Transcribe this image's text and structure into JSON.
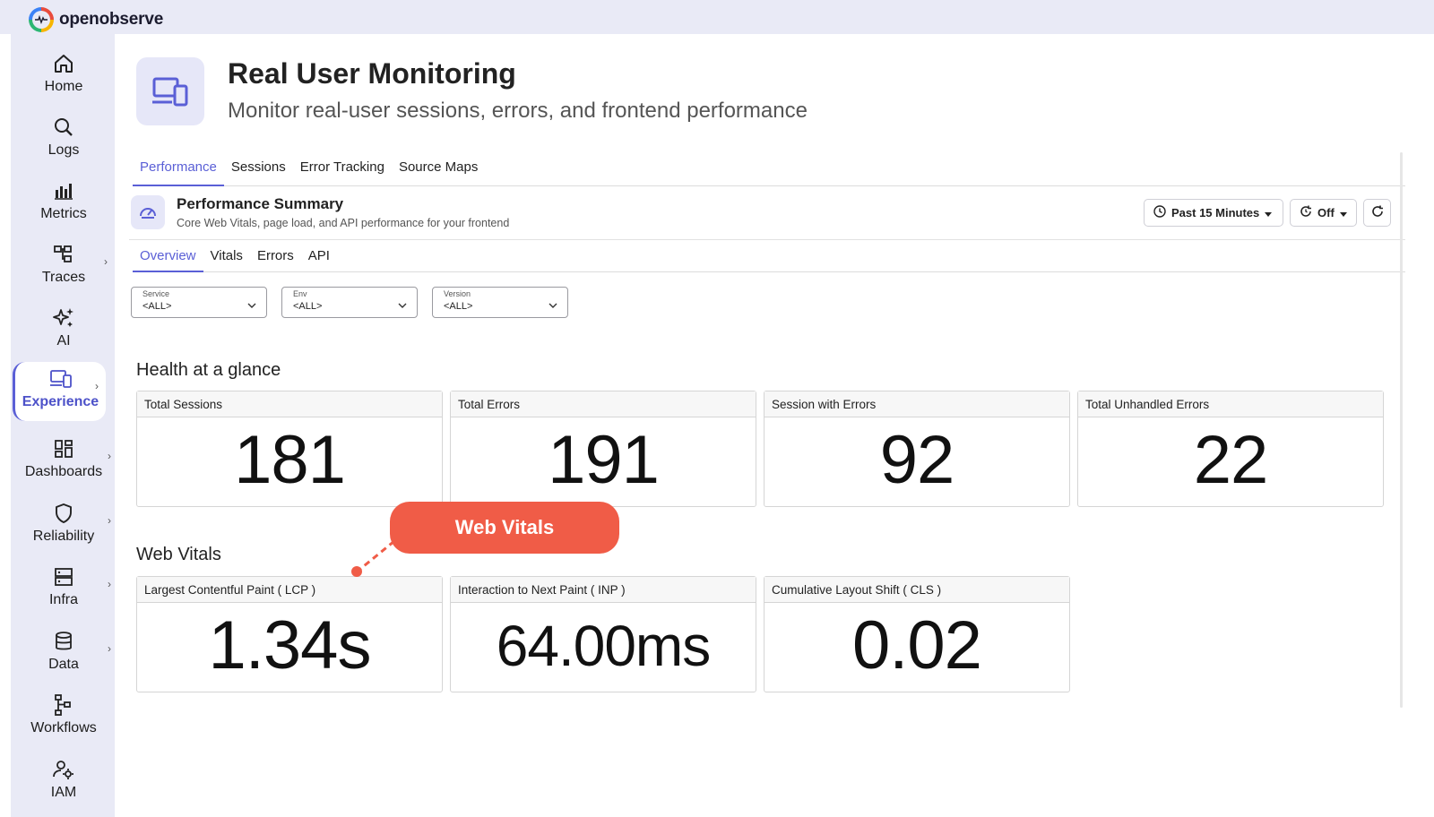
{
  "app": {
    "brand": "openobserve"
  },
  "sidebar": {
    "items": [
      {
        "label": "Home",
        "icon": "home-icon"
      },
      {
        "label": "Logs",
        "icon": "search-icon"
      },
      {
        "label": "Metrics",
        "icon": "bar-chart-icon"
      },
      {
        "label": "Traces",
        "icon": "traces-icon"
      },
      {
        "label": "AI",
        "icon": "sparkles-icon"
      },
      {
        "label": "Experience",
        "icon": "devices-icon",
        "active": true
      },
      {
        "label": "Dashboards",
        "icon": "dashboard-grid-icon"
      },
      {
        "label": "Reliability",
        "icon": "shield-icon"
      },
      {
        "label": "Infra",
        "icon": "server-icon"
      },
      {
        "label": "Data",
        "icon": "database-icon"
      },
      {
        "label": "Workflows",
        "icon": "workflow-icon"
      },
      {
        "label": "IAM",
        "icon": "user-gear-icon"
      }
    ]
  },
  "header": {
    "title": "Real User Monitoring",
    "subtitle": "Monitor real-user sessions, errors, and frontend performance"
  },
  "tabs": [
    {
      "label": "Performance",
      "active": true
    },
    {
      "label": "Sessions"
    },
    {
      "label": "Error Tracking"
    },
    {
      "label": "Source Maps"
    }
  ],
  "summary": {
    "title": "Performance Summary",
    "description": "Core Web Vitals, page load, and API performance for your frontend",
    "time_range": "Past 15 Minutes",
    "refresh": "Off"
  },
  "subtabs": [
    {
      "label": "Overview",
      "active": true
    },
    {
      "label": "Vitals"
    },
    {
      "label": "Errors"
    },
    {
      "label": "API"
    }
  ],
  "filters": [
    {
      "label": "Service",
      "value": "<ALL>"
    },
    {
      "label": "Env",
      "value": "<ALL>"
    },
    {
      "label": "Version",
      "value": "<ALL>"
    }
  ],
  "health": {
    "title": "Health at a glance",
    "cards": [
      {
        "title": "Total Sessions",
        "value": "181"
      },
      {
        "title": "Total Errors",
        "value": "191"
      },
      {
        "title": "Session with Errors",
        "value": "92"
      },
      {
        "title": "Total Unhandled Errors",
        "value": "22"
      }
    ]
  },
  "vitals": {
    "title": "Web Vitals",
    "cards": [
      {
        "title": "Largest Contentful Paint ( LCP )",
        "value": "1.34s"
      },
      {
        "title": "Interaction to Next Paint ( INP )",
        "value": "64.00ms"
      },
      {
        "title": "Cumulative Layout Shift ( CLS )",
        "value": "0.02"
      }
    ]
  },
  "callout": {
    "label": "Web Vitals",
    "color": "#f05c47"
  },
  "colors": {
    "accent": "#5a5fd6",
    "sidebar_bg": "#e9eaf6"
  }
}
